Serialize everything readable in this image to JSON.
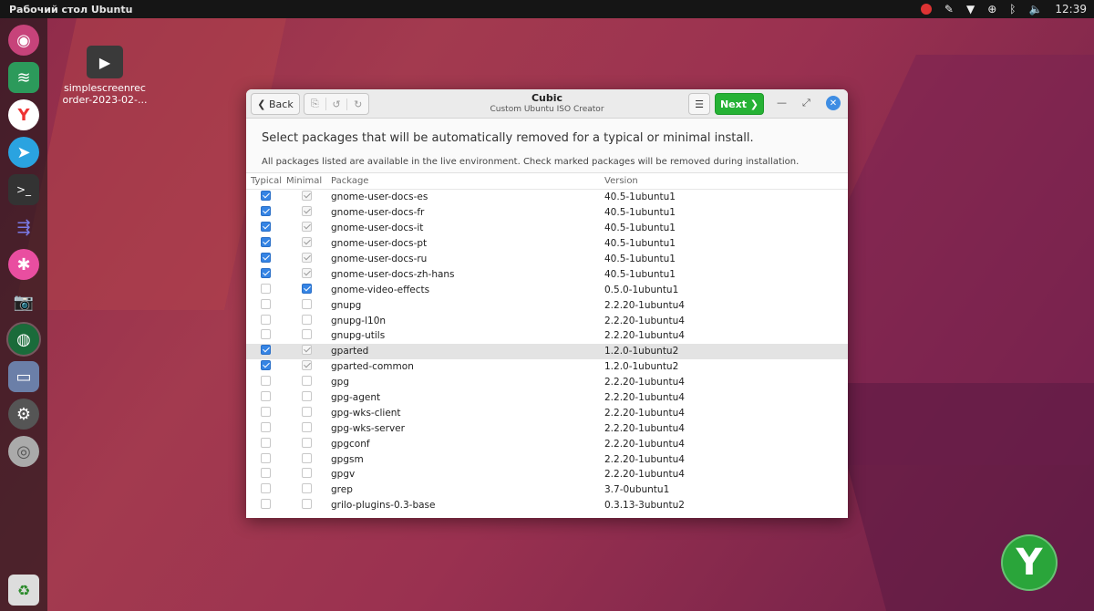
{
  "topbar": {
    "title": "Рабочий стол Ubuntu",
    "time": "12:39"
  },
  "dock": {
    "items": [
      "ubuntu-icon",
      "layers-icon",
      "yandex-icon",
      "telegram-icon",
      "terminal-icon",
      "arrows-icon",
      "paint-icon",
      "camera-icon",
      "globe-icon",
      "folder-icon",
      "settings-icon",
      "disc-icon"
    ]
  },
  "desktop": {
    "file_name_line1": "simplescreenrec",
    "file_name_line2": "order-2023-02-..."
  },
  "window": {
    "back_label": "❮ Back",
    "title": "Cubic",
    "subtitle": "Custom Ubuntu ISO Creator",
    "next_label": "Next ❯",
    "heading": "Select packages that will be automatically removed for a typical or minimal install.",
    "subheading": "All packages listed are available in the live environment. Check marked packages will be removed during installation.",
    "columns": {
      "typical": "Typical",
      "minimal": "Minimal",
      "package": "Package",
      "version": "Version"
    },
    "rows": [
      {
        "typical": "on",
        "minimal": "dis",
        "package": "gnome-user-docs-es",
        "version": "40.5-1ubuntu1"
      },
      {
        "typical": "on",
        "minimal": "dis",
        "package": "gnome-user-docs-fr",
        "version": "40.5-1ubuntu1"
      },
      {
        "typical": "on",
        "minimal": "dis",
        "package": "gnome-user-docs-it",
        "version": "40.5-1ubuntu1"
      },
      {
        "typical": "on",
        "minimal": "dis",
        "package": "gnome-user-docs-pt",
        "version": "40.5-1ubuntu1"
      },
      {
        "typical": "on",
        "minimal": "dis",
        "package": "gnome-user-docs-ru",
        "version": "40.5-1ubuntu1"
      },
      {
        "typical": "on",
        "minimal": "dis",
        "package": "gnome-user-docs-zh-hans",
        "version": "40.5-1ubuntu1"
      },
      {
        "typical": "off",
        "minimal": "on",
        "package": "gnome-video-effects",
        "version": "0.5.0-1ubuntu1"
      },
      {
        "typical": "off",
        "minimal": "off",
        "package": "gnupg",
        "version": "2.2.20-1ubuntu4"
      },
      {
        "typical": "off",
        "minimal": "off",
        "package": "gnupg-l10n",
        "version": "2.2.20-1ubuntu4"
      },
      {
        "typical": "off",
        "minimal": "off",
        "package": "gnupg-utils",
        "version": "2.2.20-1ubuntu4"
      },
      {
        "typical": "on",
        "minimal": "dis",
        "package": "gparted",
        "version": "1.2.0-1ubuntu2",
        "selected": true
      },
      {
        "typical": "on",
        "minimal": "dis",
        "package": "gparted-common",
        "version": "1.2.0-1ubuntu2"
      },
      {
        "typical": "off",
        "minimal": "off",
        "package": "gpg",
        "version": "2.2.20-1ubuntu4"
      },
      {
        "typical": "off",
        "minimal": "off",
        "package": "gpg-agent",
        "version": "2.2.20-1ubuntu4"
      },
      {
        "typical": "off",
        "minimal": "off",
        "package": "gpg-wks-client",
        "version": "2.2.20-1ubuntu4"
      },
      {
        "typical": "off",
        "minimal": "off",
        "package": "gpg-wks-server",
        "version": "2.2.20-1ubuntu4"
      },
      {
        "typical": "off",
        "minimal": "off",
        "package": "gpgconf",
        "version": "2.2.20-1ubuntu4"
      },
      {
        "typical": "off",
        "minimal": "off",
        "package": "gpgsm",
        "version": "2.2.20-1ubuntu4"
      },
      {
        "typical": "off",
        "minimal": "off",
        "package": "gpgv",
        "version": "2.2.20-1ubuntu4"
      },
      {
        "typical": "off",
        "minimal": "off",
        "package": "grep",
        "version": "3.7-0ubuntu1"
      },
      {
        "typical": "off",
        "minimal": "off",
        "package": "grilo-plugins-0.3-base",
        "version": "0.3.13-3ubuntu2"
      }
    ]
  },
  "watermark": {
    "letter": "Y"
  }
}
